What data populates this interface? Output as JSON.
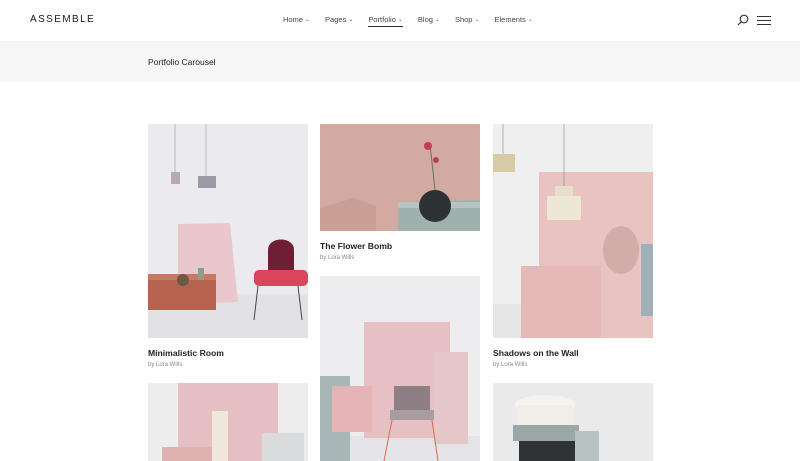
{
  "brand": {
    "name": "ASSEMBLE"
  },
  "nav": {
    "items": [
      {
        "label": "Home"
      },
      {
        "label": "Pages"
      },
      {
        "label": "Portfolio"
      },
      {
        "label": "Blog"
      },
      {
        "label": "Shop"
      },
      {
        "label": "Elements"
      }
    ],
    "active": "Portfolio"
  },
  "page": {
    "title": "Portfolio Carousel"
  },
  "portfolio": {
    "items": [
      {
        "title": "Minimalistic Room",
        "meta": "by Lora Wills"
      },
      {
        "title": "The Flower Bomb",
        "meta": "by Lora Wills"
      },
      {
        "title": "Shadows on the Wall",
        "meta": "by Lora Wills"
      }
    ]
  },
  "colors": {
    "accent_pink": "#e8c3c1",
    "header_bg": "#ffffff",
    "titlebar_bg": "#f6f6f6"
  }
}
